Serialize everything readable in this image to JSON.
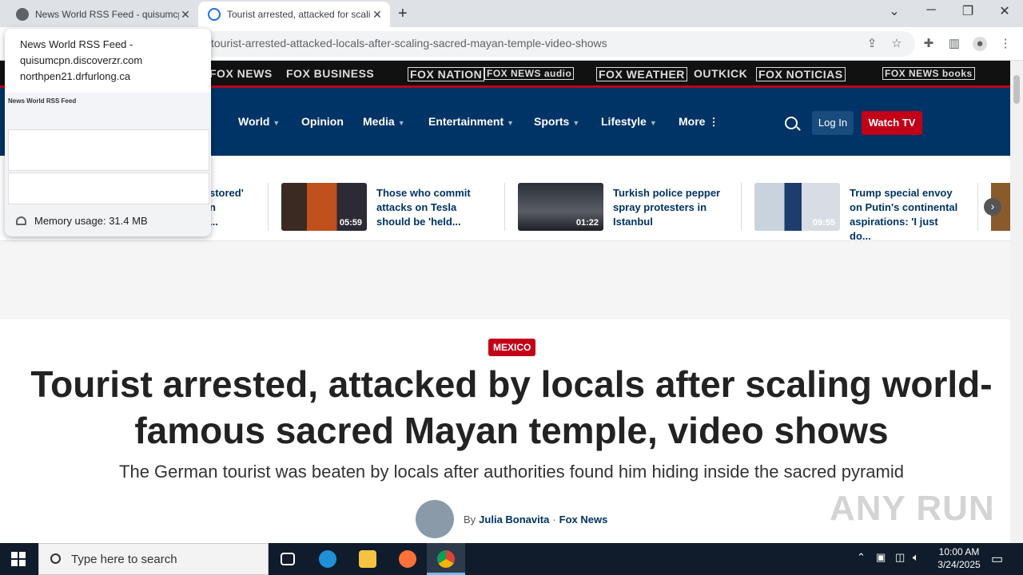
{
  "browser": {
    "tabs": [
      {
        "title": "News World RSS Feed - quisumcpn.discoverzr.com",
        "active": false
      },
      {
        "title": "Tourist arrested, attacked for scaling sacred Mayan temple",
        "active": true
      }
    ],
    "url": "tourist-arrested-attacked-locals-after-scaling-sacred-mayan-temple-video-shows"
  },
  "tab_hover": {
    "title": "News World RSS Feed - quisumcpn.discoverzr.com",
    "host": "northpen21.drfurlong.ca",
    "preview_heading": "News World RSS Feed",
    "memory": "Memory usage: 31.4 MB"
  },
  "brand_strip": [
    "FOX NEWS",
    "FOX BUSINESS",
    "FOX NATION",
    "FOX NEWS audio",
    "FOX WEATHER",
    "OUTKICK",
    "FOX NOTICIAS",
    "FOX NEWS books"
  ],
  "nav": {
    "items": [
      {
        "label": "World",
        "caret": "▼"
      },
      {
        "label": "Opinion",
        "caret": ""
      },
      {
        "label": "Media",
        "caret": "▼"
      },
      {
        "label": "Entertainment",
        "caret": "▼"
      },
      {
        "label": "Sports",
        "caret": "▼"
      },
      {
        "label": "Lifestyle",
        "caret": "▼"
      },
      {
        "label": "More",
        "caret": "⋮"
      }
    ],
    "login": "Log In",
    "watch": "Watch TV"
  },
  "videos": {
    "partial_first": [
      "stored'",
      "n",
      "..."
    ],
    "items": [
      {
        "caption": "Those who commit attacks on Tesla should be 'held...",
        "duration": "05:59"
      },
      {
        "caption": "Turkish police pepper spray protesters in Istanbul",
        "duration": "01:22"
      },
      {
        "caption": "Trump special envoy on Putin's continental aspirations: 'I just do...",
        "duration": "09:55"
      }
    ]
  },
  "article": {
    "category": "MEXICO",
    "headline": "Tourist arrested, attacked by locals after scaling world-famous sacred Mayan temple, video shows",
    "subhead": "The German tourist was beaten by locals after authorities found him hiding inside the sacred pyramid",
    "by": "By",
    "author": "Julia Bonavita",
    "separator": "·",
    "source": "Fox News"
  },
  "taskbar": {
    "search_placeholder": "Type here to search",
    "time": "10:00 AM",
    "date": "3/24/2025"
  },
  "watermark": "ANY RUN",
  "colors": {
    "fox_navy": "#003366",
    "fox_red": "#c20017"
  }
}
